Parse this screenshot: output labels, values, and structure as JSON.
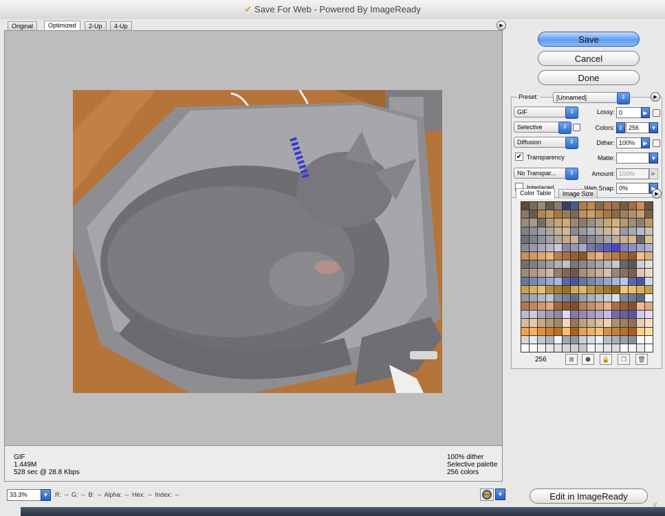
{
  "window": {
    "title": "Save For Web - Powered By ImageReady"
  },
  "tabs": [
    {
      "label": "Original",
      "active": false
    },
    {
      "label": "Optimized",
      "active": true
    },
    {
      "label": "2-Up",
      "active": false
    },
    {
      "label": "4-Up",
      "active": false
    }
  ],
  "buttons": {
    "save": "Save",
    "cancel": "Cancel",
    "done": "Done",
    "edit_in_imageready": "Edit in ImageReady"
  },
  "settings": {
    "preset_label": "Preset:",
    "preset_value": "[Unnamed]",
    "format": "GIF",
    "lossy_label": "Lossy:",
    "lossy_value": "0",
    "palette": "Selective",
    "colors_label": "Colors:",
    "colors_value": "256",
    "dither_method": "Diffusion",
    "dither_label": "Dither:",
    "dither_value": "100%",
    "transparency_label": "Transparency",
    "transparency_checked": true,
    "matte_label": "Matte:",
    "matte_value": "",
    "transparency_dither": "No Transpar...",
    "amount_label": "Amount:",
    "amount_value": "100%",
    "interlaced_label": "Interlaced",
    "interlaced_checked": false,
    "websnap_label": "Web Snap:",
    "websnap_value": "0%"
  },
  "color_table": {
    "tabs": [
      "Color Table",
      "Image Size"
    ],
    "count": "256",
    "swatches": [
      "#5b4a3a",
      "#7c6a5a",
      "#9a8a7a",
      "#6a5a4a",
      "#8c7c6c",
      "#3c3c64",
      "#4a5a8a",
      "#a88050",
      "#c08a4a",
      "#8a6a4a",
      "#b07848",
      "#9c7050",
      "#7a5a3a",
      "#a07040",
      "#c89058",
      "#6c5440",
      "#8a7868",
      "#6a5a50",
      "#b08858",
      "#c8985a",
      "#a8784a",
      "#9a7a5a",
      "#7a6a5a",
      "#c09060",
      "#d0a068",
      "#b88a50",
      "#a87848",
      "#8a6a4a",
      "#9a8060",
      "#b09070",
      "#c8a070",
      "#7a6048",
      "#9c8c7c",
      "#a89888",
      "#7a6c60",
      "#b49c7c",
      "#c4a478",
      "#d4a870",
      "#a08870",
      "#8c7c6c",
      "#9a9080",
      "#b0a090",
      "#c8a878",
      "#d8b080",
      "#b89870",
      "#a08c78",
      "#8c8070",
      "#c09868",
      "#80808c",
      "#9090a0",
      "#a0a0b0",
      "#b0a8a0",
      "#c0b0a0",
      "#d0b898",
      "#8c8898",
      "#9c98a8",
      "#acacb8",
      "#bcb0a8",
      "#ccb8a0",
      "#dcc0a0",
      "#9898a8",
      "#a8a8b8",
      "#b8b8c8",
      "#c8c0b8",
      "#707078",
      "#808088",
      "#909098",
      "#a0a0a8",
      "#b0a898",
      "#c0a888",
      "#d0b090",
      "#787880",
      "#888890",
      "#9898a0",
      "#a8a8b0",
      "#b8b0a0",
      "#c8b090",
      "#d8b888",
      "#686870",
      "#e0c090",
      "#888898",
      "#9898a8",
      "#a8a8b8",
      "#b8b8c8",
      "#c8c8d8",
      "#8888a0",
      "#9898b0",
      "#a8a8c0",
      "#7878a0",
      "#6868a8",
      "#5858c0",
      "#4848c8",
      "#8080b8",
      "#9090c0",
      "#a0a0c8",
      "#b0b0d0",
      "#c89060",
      "#d09868",
      "#e0a870",
      "#f0b878",
      "#b88050",
      "#a87040",
      "#986030",
      "#885828",
      "#d8a070",
      "#e8b080",
      "#c88858",
      "#b87848",
      "#a86838",
      "#985830",
      "#f0c088",
      "#e0b078",
      "#707070",
      "#808080",
      "#909090",
      "#a0a0a0",
      "#b0b0b0",
      "#c0c0c0",
      "#787878",
      "#888888",
      "#989898",
      "#a8a8a8",
      "#b8b8b8",
      "#c8c8c8",
      "#686868",
      "#585858",
      "#d0d0d0",
      "#e0e0e0",
      "#a08878",
      "#b09888",
      "#c0a898",
      "#d0b8a8",
      "#908070",
      "#806858",
      "#705848",
      "#a89080",
      "#b8a090",
      "#c8b0a0",
      "#d8c0b0",
      "#988878",
      "#887060",
      "#786050",
      "#e0c8b8",
      "#f0d8c8",
      "#6878a0",
      "#7888b0",
      "#8898c0",
      "#98a8d0",
      "#a8b8e0",
      "#5868a0",
      "#485898",
      "#687898",
      "#7888a8",
      "#8898b8",
      "#98a8c8",
      "#a8b8d8",
      "#b8c8e8",
      "#5868b0",
      "#4858a8",
      "#c8d8f0",
      "#c8a050",
      "#d8b060",
      "#e8c070",
      "#b89040",
      "#a88030",
      "#987020",
      "#d0a858",
      "#e0b868",
      "#c09848",
      "#b08838",
      "#a07828",
      "#906818",
      "#f0c878",
      "#e8c068",
      "#d8b058",
      "#c8a048",
      "#9098a0",
      "#a0a8b0",
      "#b0b8c0",
      "#c0c8d0",
      "#8890a0",
      "#788090",
      "#687080",
      "#98a0a8",
      "#a8b0b8",
      "#b8c0c8",
      "#c8d0d8",
      "#d8e0e8",
      "#8088a0",
      "#707890",
      "#606880",
      "#e8f0f8",
      "#b07850",
      "#c08860",
      "#d09870",
      "#e0a880",
      "#a06840",
      "#905830",
      "#805028",
      "#b88058",
      "#c89068",
      "#d8a078",
      "#e8b088",
      "#a87048",
      "#986038",
      "#885030",
      "#f0b890",
      "#e0a880",
      "#c0b8d0",
      "#d0c8e0",
      "#b0a8c0",
      "#a098b0",
      "#9088a0",
      "#e0d8f0",
      "#8878a8",
      "#9888b8",
      "#a898c8",
      "#b8a8d8",
      "#c8b8e8",
      "#7868a0",
      "#686098",
      "#5858a0",
      "#d8c8f0",
      "#e8d8f8",
      "#d8b898",
      "#e8c8a8",
      "#c8a888",
      "#b89878",
      "#a88868",
      "#f8d8b8",
      "#987858",
      "#c0a080",
      "#d0b090",
      "#e0c0a0",
      "#f0d0b0",
      "#b09070",
      "#a08060",
      "#907050",
      "#e8d0b0",
      "#f8e0c0",
      "#f0a050",
      "#f8b060",
      "#e09040",
      "#d08030",
      "#c07020",
      "#f8c070",
      "#b06018",
      "#e8a058",
      "#f0b068",
      "#f8c078",
      "#d89048",
      "#c88038",
      "#b87028",
      "#a86018",
      "#fcd090",
      "#fce0a0",
      "#d0d8e0",
      "#e0e8f0",
      "#c0c8d0",
      "#b0b8c0",
      "#f0f8ff",
      "#a0a8b0",
      "#9098a0",
      "#c8d0d8",
      "#d8e0e8",
      "#e8f0f8",
      "#b8c0c8",
      "#a8b0b8",
      "#98a0a8",
      "#8890a0",
      "#f8f8f8",
      "#ffffff",
      "#ffffff",
      "#f8f8f8",
      "#f0f0f0",
      "#e8e8e8",
      "#e0e0e0",
      "#d8d8d8",
      "#d0d0d0",
      "#c8c8c8",
      "#f4f4f4",
      "#ececec",
      "#e4e4e4",
      "#dcdcdc",
      "#fafafa",
      "#f2f2f2",
      "#eaeaea",
      "#ffffff"
    ]
  },
  "info": {
    "format": "GIF",
    "size": "1.449M",
    "download": "528 sec @ 28.8 Kbps",
    "dither": "100% dither",
    "palette": "Selective palette",
    "colors": "256 colors"
  },
  "status": {
    "zoom": "33.3%",
    "readout": "R:   --   G:   --   B:   --   Alpha:   --   Hex:        --   Index:   --"
  },
  "colors": {
    "save_blue": "#5d9bf1",
    "preview_bg": "#bdbdbd"
  }
}
